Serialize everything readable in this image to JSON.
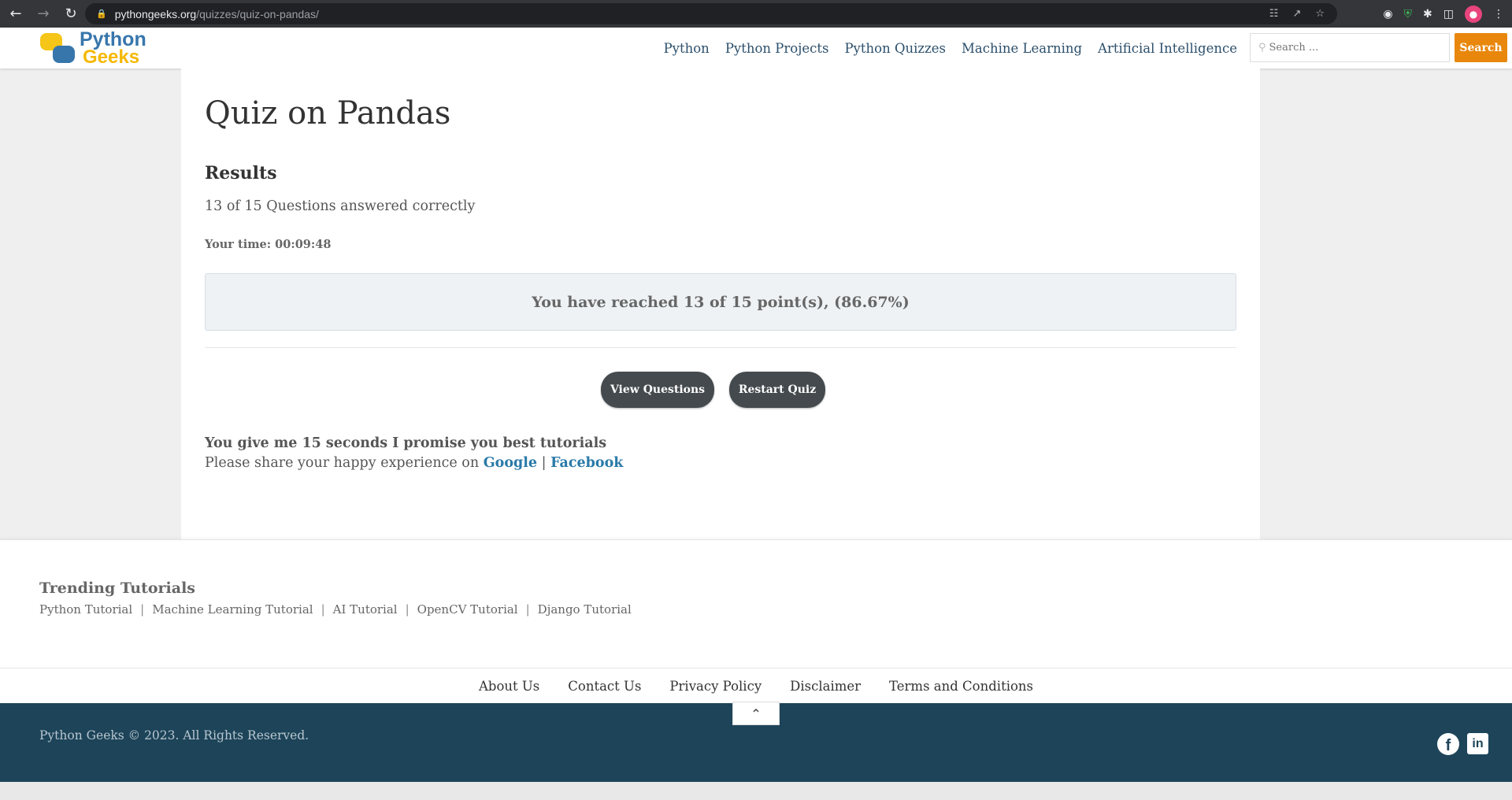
{
  "browser": {
    "url_domain": "pythongeeks.org",
    "url_path": "/quizzes/quiz-on-pandas/",
    "icons": [
      "back-icon",
      "forward-icon",
      "reload-icon",
      "lock-icon",
      "translate-icon",
      "share-icon",
      "star-icon",
      "globe-icon",
      "shield-icon",
      "puzzle-icon",
      "sidepanel-icon",
      "avatar",
      "menu-icon"
    ]
  },
  "header": {
    "logo_line1": "Python",
    "logo_line2": "Geeks",
    "nav": [
      "Python",
      "Python Projects",
      "Python Quizzes",
      "Machine Learning",
      "Artificial Intelligence"
    ],
    "search_placeholder": "Search ...",
    "search_button": "Search"
  },
  "main": {
    "title": "Quiz on Pandas",
    "results_heading": "Results",
    "answered": "13 of 15 Questions answered correctly",
    "time": "Your time: 00:09:48",
    "points": "You have reached 13 of 15 point(s), (86.67%)",
    "view_button": "View Questions",
    "restart_button": "Restart Quiz",
    "promise": "You give me 15 seconds I promise you best tutorials",
    "share_prefix": "Please share your happy experience on",
    "share_google": "Google",
    "share_sep": "|",
    "share_facebook": "Facebook"
  },
  "trending": {
    "heading": "Trending Tutorials",
    "links": [
      "Python Tutorial",
      "Machine Learning Tutorial",
      "AI Tutorial",
      "OpenCV Tutorial",
      "Django Tutorial"
    ]
  },
  "footer": {
    "nav": [
      "About Us",
      "Contact Us",
      "Privacy Policy",
      "Disclaimer",
      "Terms and Conditions"
    ],
    "copyright": "Python Geeks © 2023. All Rights Reserved.",
    "social": [
      "facebook-icon",
      "linkedin-icon"
    ]
  },
  "colors": {
    "accent_orange": "#e8870b",
    "footer_bg": "#1d4459",
    "link_blue": "#2a7aa8",
    "button_dark": "#444a4d"
  }
}
